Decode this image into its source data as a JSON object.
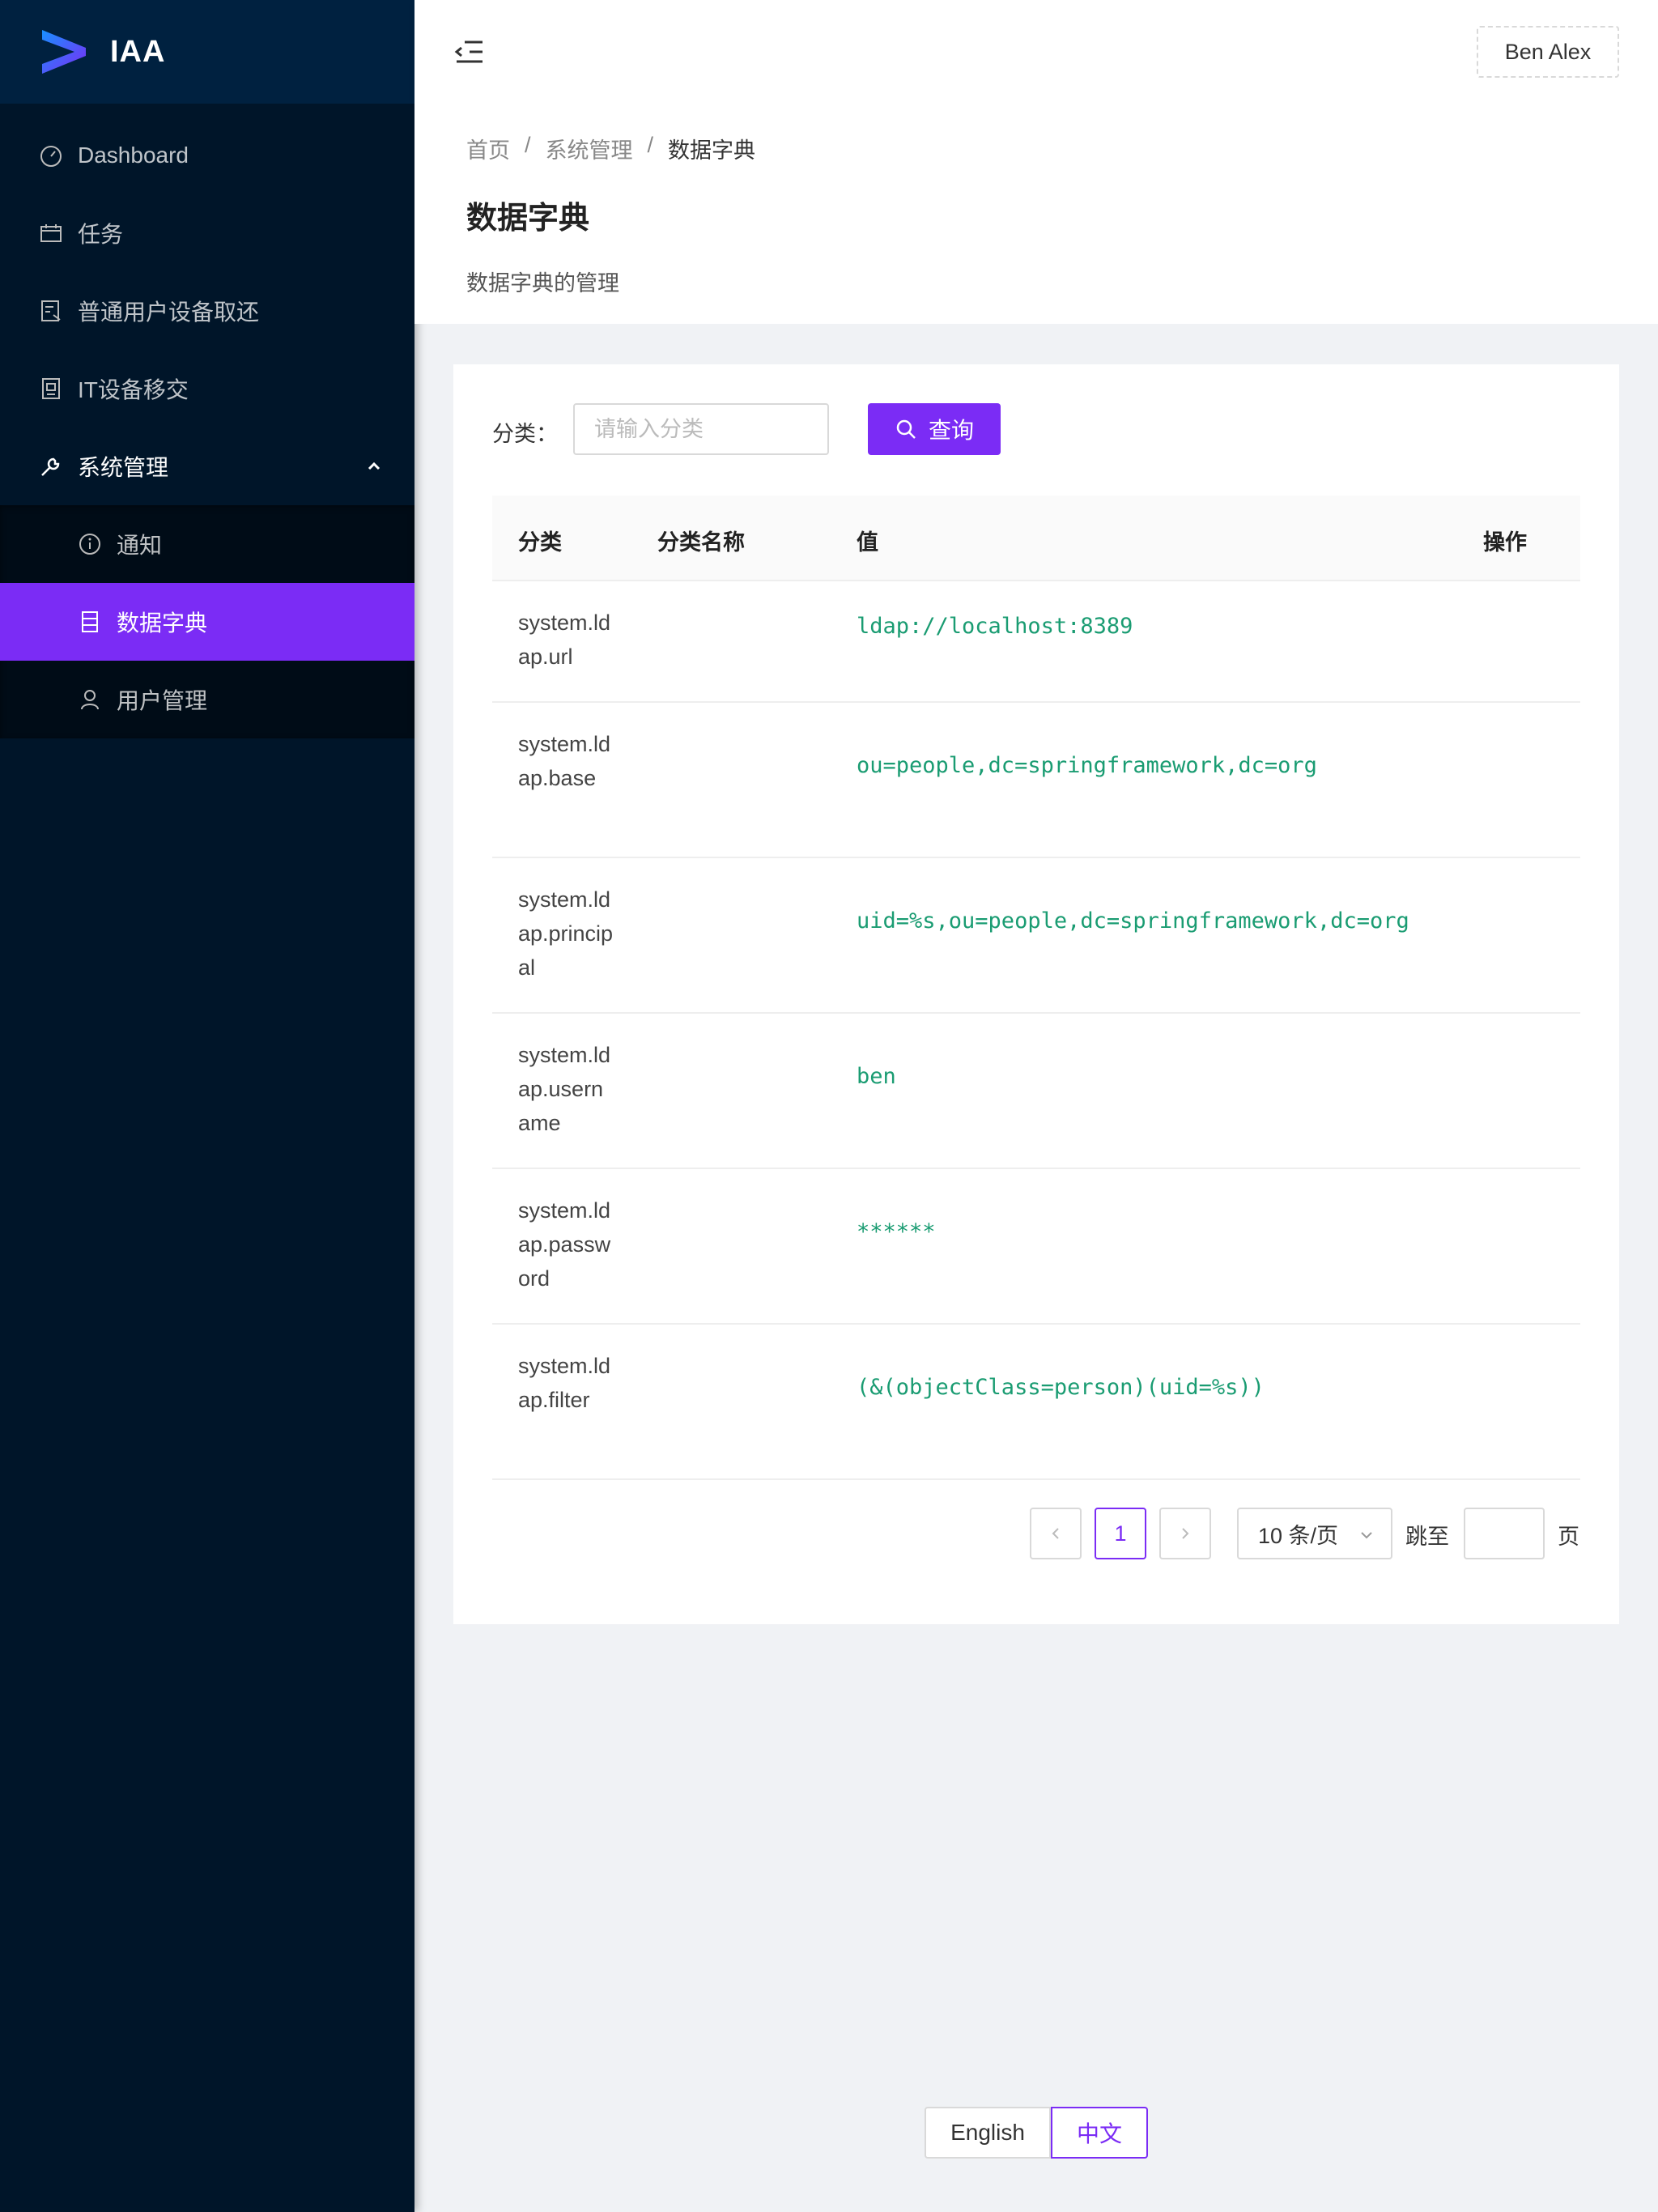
{
  "app": {
    "name": "IAA"
  },
  "sidebar": {
    "items": [
      {
        "label": "Dashboard",
        "icon": "dashboard-icon"
      },
      {
        "label": "任务",
        "icon": "calendar-icon"
      },
      {
        "label": "普通用户设备取还",
        "icon": "form-icon"
      },
      {
        "label": "IT设备移交",
        "icon": "doc-icon"
      },
      {
        "label": "系统管理",
        "icon": "tool-icon",
        "expanded": true
      }
    ],
    "sub_items": [
      {
        "label": "通知",
        "icon": "info-circle-icon"
      },
      {
        "label": "数据字典",
        "icon": "profile-icon",
        "active": true
      },
      {
        "label": "用户管理",
        "icon": "user-icon"
      }
    ]
  },
  "header": {
    "user": "Ben Alex"
  },
  "breadcrumb": [
    "首页",
    "/",
    "系统管理",
    "/",
    "数据字典"
  ],
  "page": {
    "title": "数据字典",
    "description": "数据字典的管理"
  },
  "search": {
    "label": "分类：",
    "placeholder": "请输入分类",
    "button": "查询"
  },
  "table": {
    "columns": [
      "分类",
      "分类名称",
      "值",
      "操作"
    ],
    "rows": [
      {
        "category": "system.ldap.url",
        "name": "",
        "value": "ldap://localhost:8389"
      },
      {
        "category": "system.ldap.base",
        "name": "",
        "value": "ou=people,dc=springframework,dc=org"
      },
      {
        "category": "system.ldap.principal",
        "name": "",
        "value": "uid=%s,ou=people,dc=springframework,dc=org"
      },
      {
        "category": "system.ldap.username",
        "name": "",
        "value": "ben"
      },
      {
        "category": "system.ldap.password",
        "name": "",
        "value": "******"
      },
      {
        "category": "system.ldap.filter",
        "name": "",
        "value": "(&(objectClass=person)(uid=%s))"
      }
    ]
  },
  "pagination": {
    "current": "1",
    "page_size": "10 条/页",
    "jump_label": "跳至",
    "page_suffix": "页"
  },
  "language": {
    "english": "English",
    "chinese": "中文",
    "selected": "中文"
  },
  "colors": {
    "primary": "#7b2cf5",
    "sidebar": "#001529",
    "value_text": "#1a9c72"
  }
}
